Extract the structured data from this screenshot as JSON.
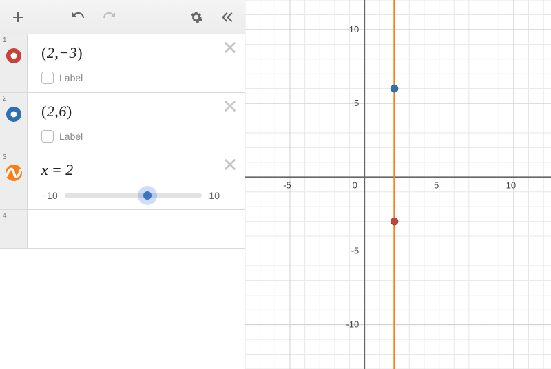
{
  "toolbar": {
    "add": "+",
    "undo": "undo",
    "redo": "redo",
    "settings": "settings",
    "collapse": "«"
  },
  "expressions": [
    {
      "index": "1",
      "icon": "point-red",
      "colorOuter": "#c7423a",
      "colorInner": "#ffffff",
      "formulaHtml": "(2,−3)",
      "hasLabel": true,
      "labelText": "Label"
    },
    {
      "index": "2",
      "icon": "point-blue",
      "colorOuter": "#2d70b3",
      "colorInner": "#ffffff",
      "formulaHtml": "(2,6)",
      "hasLabel": true,
      "labelText": "Label"
    },
    {
      "index": "3",
      "icon": "wave-orange",
      "formulaHtml": "x = 2",
      "slider": {
        "min": "−10",
        "max": "10",
        "value": 2,
        "range": [
          -10,
          10
        ]
      }
    },
    {
      "index": "4",
      "empty": true
    }
  ],
  "chart_data": {
    "type": "scatter",
    "xlim": [
      -8,
      12.5
    ],
    "ylim": [
      -13,
      12
    ],
    "xticks": [
      -5,
      0,
      5,
      10
    ],
    "yticks": [
      -10,
      -5,
      5,
      10
    ],
    "series": [
      {
        "name": "point-red",
        "color": "#c7423a",
        "points": [
          [
            2,
            -3
          ]
        ]
      },
      {
        "name": "point-blue",
        "color": "#2d70b3",
        "points": [
          [
            2,
            6
          ]
        ]
      }
    ],
    "lines": [
      {
        "name": "x=2",
        "color": "#fa7e19",
        "type": "vertical",
        "x": 2
      }
    ]
  }
}
